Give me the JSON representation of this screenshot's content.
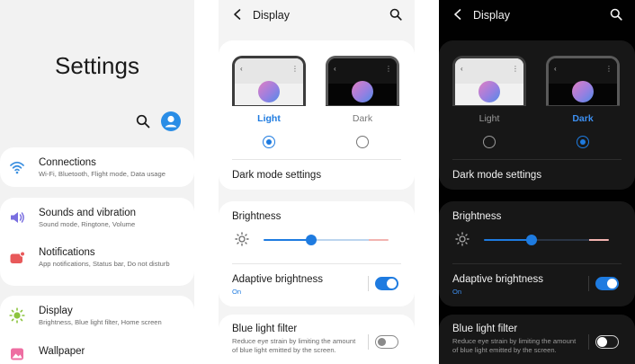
{
  "settings_screen": {
    "title": "Settings",
    "items": [
      {
        "icon": "wifi-icon",
        "title": "Connections",
        "subtitle": "Wi-Fi, Bluetooth, Flight mode, Data usage"
      },
      {
        "icon": "volume-icon",
        "title": "Sounds and vibration",
        "subtitle": "Sound mode, Ringtone, Volume"
      },
      {
        "icon": "notification-icon",
        "title": "Notifications",
        "subtitle": "App notifications, Status bar, Do not disturb"
      },
      {
        "icon": "sun-icon",
        "title": "Display",
        "subtitle": "Brightness, Blue light filter, Home screen"
      },
      {
        "icon": "wallpaper-icon",
        "title": "Wallpaper",
        "subtitle": ""
      }
    ]
  },
  "display_screen": {
    "title": "Display",
    "theme_options": {
      "light": "Light",
      "dark": "Dark"
    },
    "dark_mode_settings": "Dark mode settings",
    "brightness_label": "Brightness",
    "brightness_level": 0.38,
    "adaptive_brightness": {
      "title": "Adaptive brightness",
      "status": "On"
    },
    "blue_light_filter": {
      "title": "Blue light filter",
      "subtitle": "Reduce eye strain by limiting the amount of blue light emitted by the screen."
    }
  },
  "light_variant": {
    "selected": "light",
    "adaptive_on": true,
    "blue_light_on": false
  },
  "dark_variant": {
    "selected": "dark",
    "adaptive_on": true,
    "blue_light_on": false
  },
  "colors": {
    "accent": "#1e7be0",
    "dark_background": "#010101",
    "light_background": "#f4f4f4"
  }
}
